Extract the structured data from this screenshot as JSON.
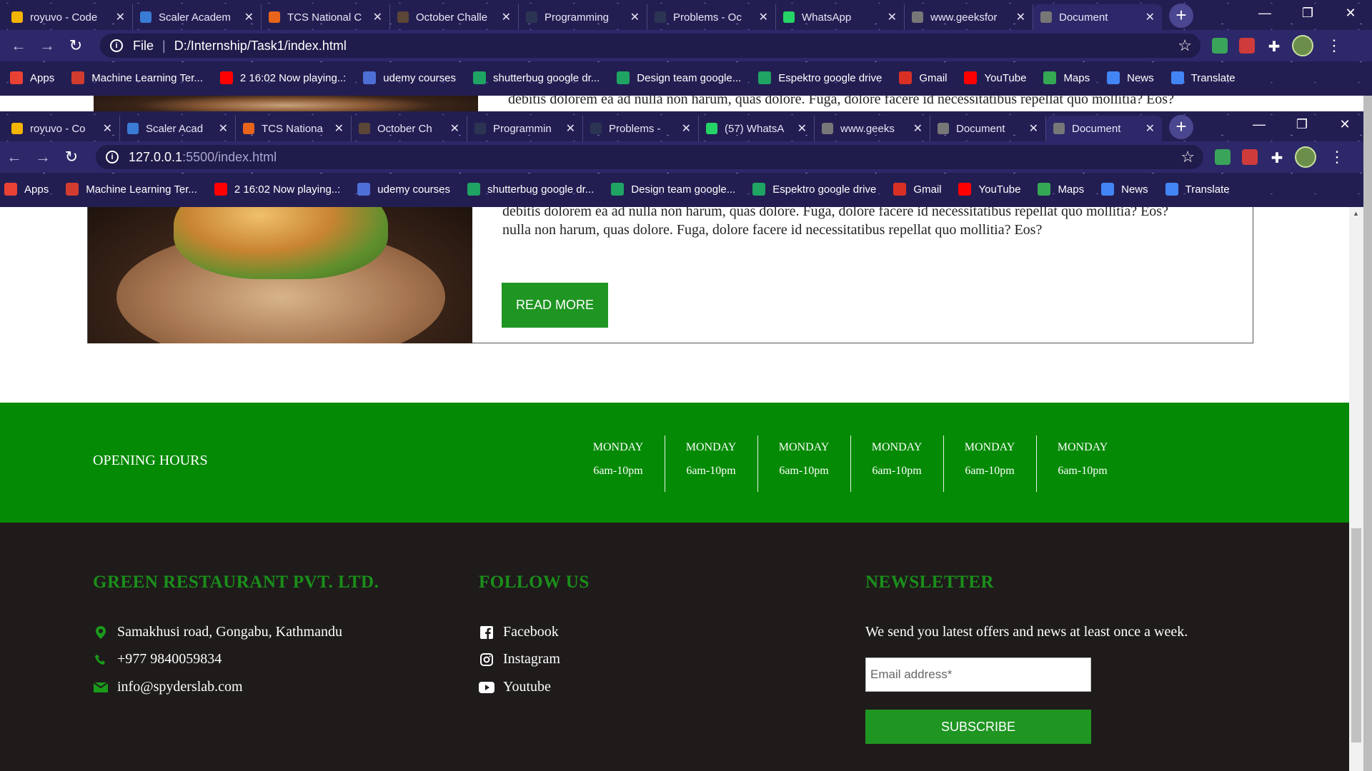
{
  "back_window": {
    "tabs": [
      {
        "title": "royuvo - Code",
        "icon": "chart-icon",
        "color": "#f4b400"
      },
      {
        "title": "Scaler Academ",
        "icon": "scaler-icon",
        "color": "#3a7bd5"
      },
      {
        "title": "TCS National C",
        "icon": "tcs-icon",
        "color": "#e8641b"
      },
      {
        "title": "October Challe",
        "icon": "codechef-icon",
        "color": "#5b4638"
      },
      {
        "title": "Programming",
        "icon": "hackerearth-icon",
        "color": "#2c3454"
      },
      {
        "title": "Problems - Oc",
        "icon": "hackerearth-icon",
        "color": "#2c3454"
      },
      {
        "title": "WhatsApp",
        "icon": "whatsapp-icon",
        "color": "#25d366"
      },
      {
        "title": "www.geeksfor",
        "icon": "globe-icon",
        "color": "#777"
      },
      {
        "title": "Document",
        "icon": "globe-icon",
        "color": "#777"
      }
    ],
    "address": {
      "scheme": "File",
      "url": "D:/Internship/Task1/index.html"
    }
  },
  "front_window": {
    "tabs": [
      {
        "title": "royuvo - Co",
        "icon": "chart-icon",
        "color": "#f4b400"
      },
      {
        "title": "Scaler Acad",
        "icon": "scaler-icon",
        "color": "#3a7bd5"
      },
      {
        "title": "TCS Nationa",
        "icon": "tcs-icon",
        "color": "#e8641b"
      },
      {
        "title": "October Ch",
        "icon": "codechef-icon",
        "color": "#5b4638"
      },
      {
        "title": "Programmin",
        "icon": "hackerearth-icon",
        "color": "#2c3454"
      },
      {
        "title": "Problems - ",
        "icon": "hackerearth-icon",
        "color": "#2c3454"
      },
      {
        "title": "(57) WhatsA",
        "icon": "whatsapp-icon",
        "color": "#25d366"
      },
      {
        "title": "www.geeks",
        "icon": "globe-icon",
        "color": "#777"
      },
      {
        "title": "Document",
        "icon": "globe-icon",
        "color": "#777"
      },
      {
        "title": "Document",
        "icon": "globe-icon",
        "color": "#777"
      }
    ],
    "address": {
      "host": "127.0.0.1",
      "path": ":5500/index.html"
    }
  },
  "bookmarks": [
    {
      "label": "Apps",
      "icon": "apps-grid-icon",
      "color": "#e94235"
    },
    {
      "label": "Machine Learning Ter...",
      "icon": "ml-logo-icon",
      "color": "#d23c2f"
    },
    {
      "label": "2 16:02 Now playing..:",
      "icon": "youtube-icon",
      "color": "#ff0000"
    },
    {
      "label": "udemy courses",
      "icon": "udemy-icon",
      "color": "#4d6fd6"
    },
    {
      "label": "shutterbug google dr...",
      "icon": "drive-icon",
      "color": "#1fa463"
    },
    {
      "label": "Design team google...",
      "icon": "drive-icon",
      "color": "#1fa463"
    },
    {
      "label": "Espektro google drive",
      "icon": "drive-icon",
      "color": "#1fa463"
    },
    {
      "label": "Gmail",
      "icon": "gmail-icon",
      "color": "#d93025"
    },
    {
      "label": "YouTube",
      "icon": "youtube-icon",
      "color": "#ff0000"
    },
    {
      "label": "Maps",
      "icon": "maps-icon",
      "color": "#34a853"
    },
    {
      "label": "News",
      "icon": "news-icon",
      "color": "#4285f4"
    },
    {
      "label": "Translate",
      "icon": "translate-icon",
      "color": "#4285f4"
    }
  ],
  "page": {
    "back_text": "debitis dolorem ea ad nulla non harum, quas dolore. Fuga, dolore facere id necessitatibus repellat quo mollitia? Eos?",
    "paragraph_line1": "debitis dolorem ea ad nulla non harum, quas dolore. Fuga, dolore facere id necessitatibus repellat quo mollitia? Eos?",
    "paragraph_line2": "nulla non harum, quas dolore. Fuga, dolore facere id necessitatibus repellat quo mollitia? Eos?",
    "read_more": "READ MORE",
    "opening_hours": {
      "title": "OPENING HOURS",
      "days": [
        {
          "day": "MONDAY",
          "hours": "6am-10pm"
        },
        {
          "day": "MONDAY",
          "hours": "6am-10pm"
        },
        {
          "day": "MONDAY",
          "hours": "6am-10pm"
        },
        {
          "day": "MONDAY",
          "hours": "6am-10pm"
        },
        {
          "day": "MONDAY",
          "hours": "6am-10pm"
        },
        {
          "day": "MONDAY",
          "hours": "6am-10pm"
        }
      ]
    },
    "footer": {
      "company": {
        "heading": "GREEN RESTAURANT PVT. LTD.",
        "address": "Samakhusi road, Gongabu, Kathmandu",
        "phone": "+977 9840059834",
        "email": "info@spyderslab.com"
      },
      "follow": {
        "heading": "FOLLOW US",
        "links": [
          "Facebook",
          "Instagram",
          "Youtube"
        ]
      },
      "newsletter": {
        "heading": "NEWSLETTER",
        "text": "We send you latest offers and news at least once a week.",
        "placeholder": "Email address*",
        "button": "SUBSCRIBE"
      }
    },
    "colors": {
      "green": "#058a05",
      "accent": "#1f9522",
      "footer_bg": "#1f1b1b"
    }
  }
}
